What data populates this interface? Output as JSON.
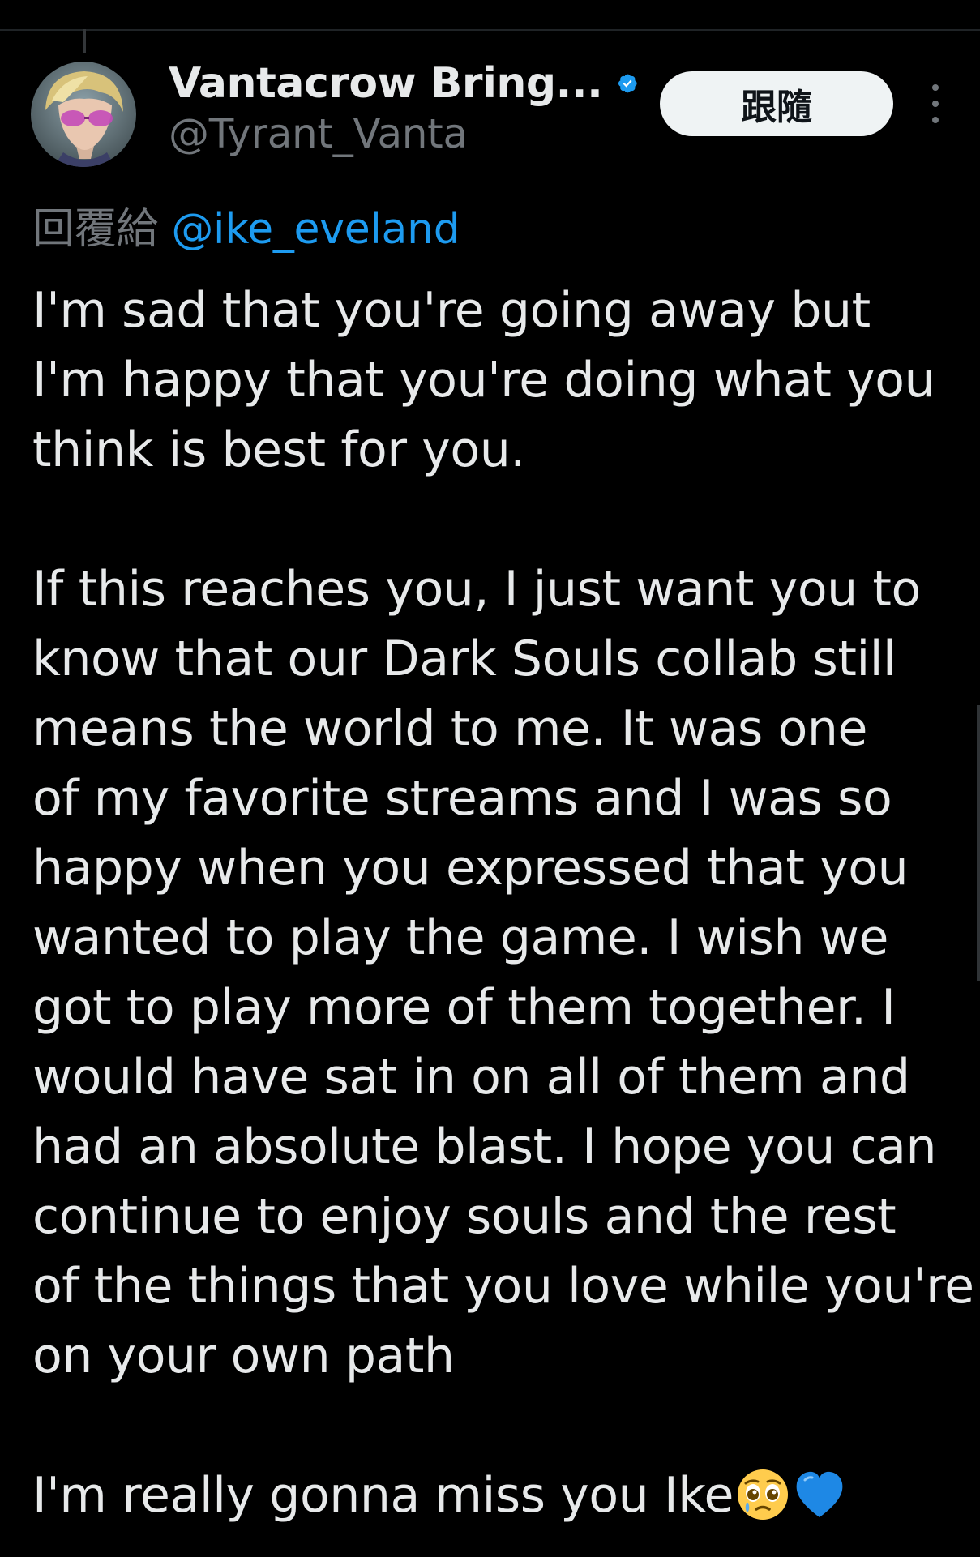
{
  "tweet": {
    "display_name": "Vantacrow Bring...",
    "handle": "@Tyrant_Vanta",
    "follow_label": "跟隨",
    "reply_prefix": "回覆給",
    "reply_mention": "@ike_eveland",
    "paragraphs": [
      {
        "lines": [
          "I'm sad that you're going away but",
          "I'm happy that you're doing what you",
          "think is best for you."
        ]
      },
      {
        "lines": [
          "If this reaches you, I just want you to",
          "know that our Dark Souls collab still",
          "means the world to me. It was one",
          "of my favorite streams and I was so",
          "happy when you expressed that you",
          "wanted to play the game. I wish we",
          "got to play more of them together. I",
          "would have sat in on all of them and",
          "had an absolute blast. I hope you can",
          "continue to enjoy souls and the rest",
          "of the things that you love while you're",
          "on your own path"
        ]
      },
      {
        "lines": [
          "I'm really gonna miss you Ike"
        ],
        "emojis": [
          "pleading-face-with-tear",
          "blue-heart"
        ]
      }
    ]
  },
  "icons": {
    "verified": "verified-badge-icon",
    "more": "more-options-icon"
  },
  "colors": {
    "background": "#000000",
    "text": "#e7e9ea",
    "secondary_text": "#71767b",
    "mention": "#1d9bf0",
    "verified": "#1d9bf0",
    "follow_button_bg": "#eff3f4",
    "follow_button_text": "#0f1419"
  }
}
